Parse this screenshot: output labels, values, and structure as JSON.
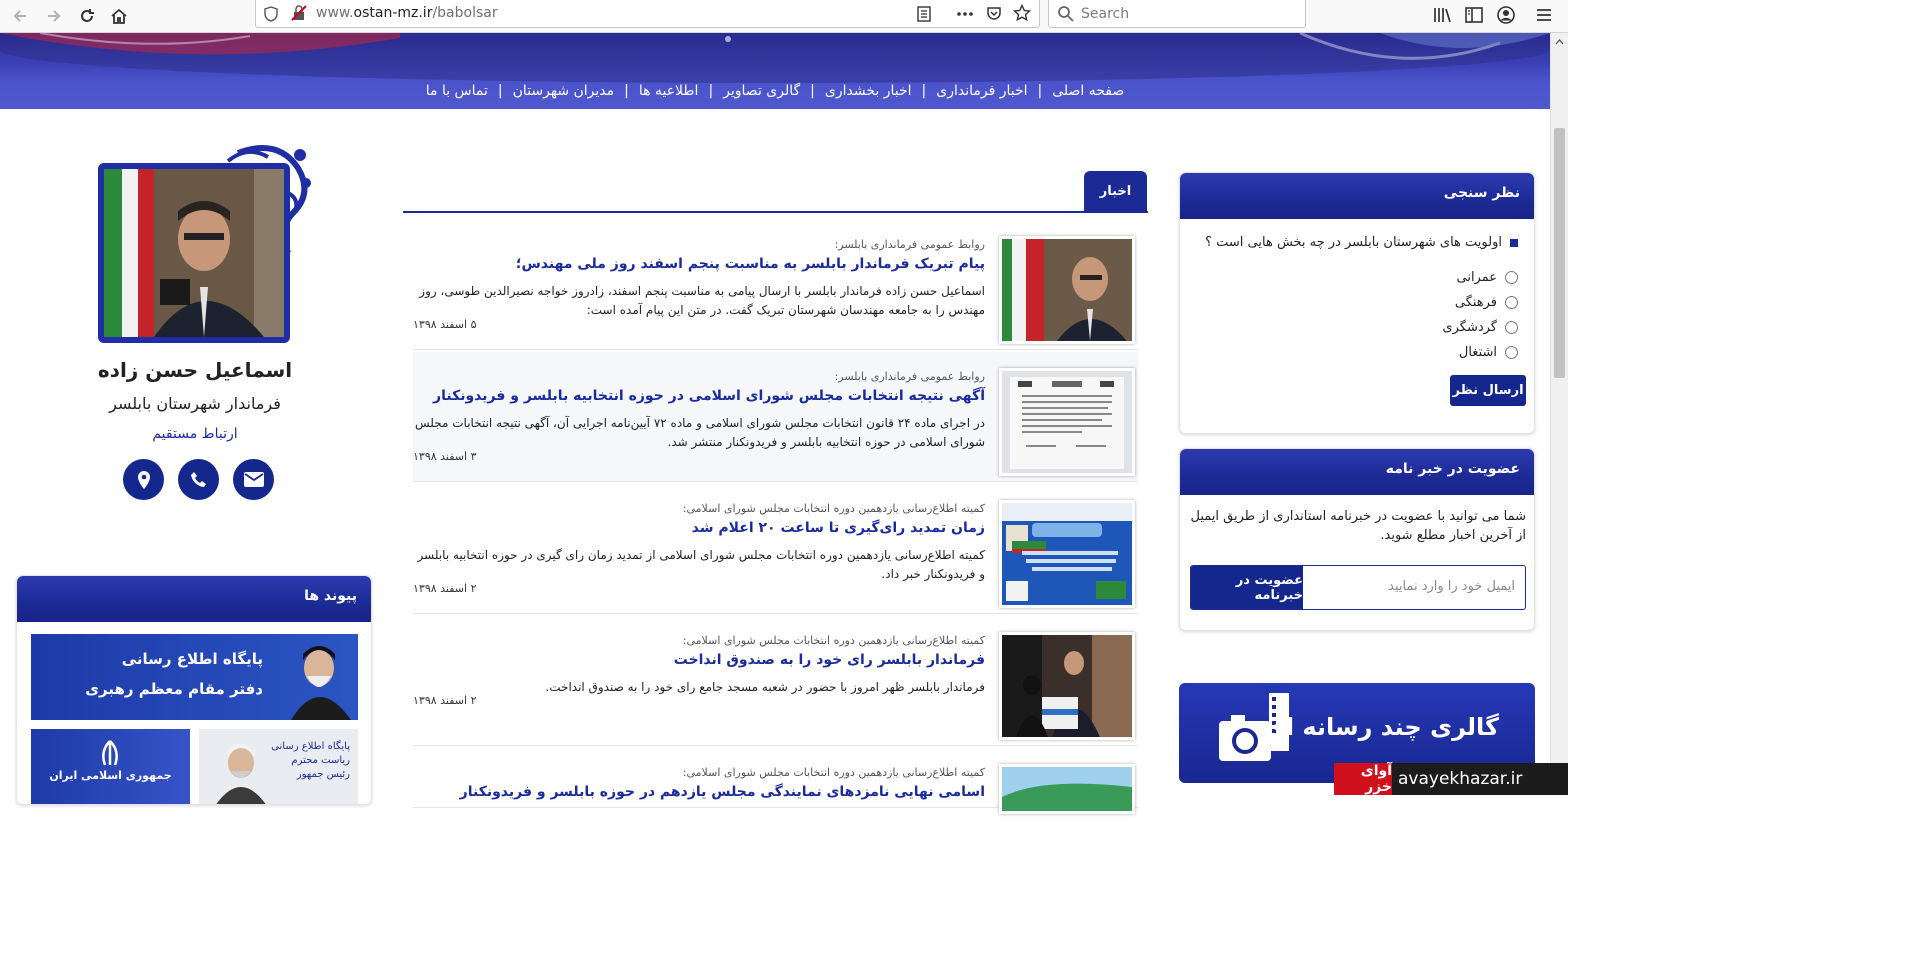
{
  "browser": {
    "url_host_prefix": "www.",
    "url_domain": "ostan-mz.ir",
    "url_path": "/babolsar",
    "search_placeholder": "Search"
  },
  "nav": {
    "items": [
      "صفحه اصلی",
      "اخبار فرمانداری",
      "اخبار بخشداری",
      "گالری تصاویر",
      "اطلاعیه ها",
      "مدیران شهرستان",
      "تماس با ما"
    ]
  },
  "poll": {
    "title": "نظر سنجی",
    "question": "اولویت های شهرستان بابلسر در چه بخش هایی است ؟",
    "options": [
      "عمرانی",
      "فرهنگی",
      "گردشگری",
      "اشتغال"
    ],
    "submit": "ارسال نظر"
  },
  "newsletter": {
    "title": "عضویت در خبر نامه",
    "text": "شما می توانید با عضویت در خبرنامه استانداری از طریق ایمیل از آخرین اخبار مطلع شوید.",
    "placeholder": "ایمیل خود را وارد نمایید",
    "button": "عضویت در خبرنامه"
  },
  "gallery_banner": {
    "text": "گالری چند رسانه ای"
  },
  "news": {
    "tab": "اخبار",
    "items": [
      {
        "source": "روابط عمومی فرمانداری بابلسر:",
        "title": "پیام تبریک فرماندار بابلسر به مناسبت پنجم اسفند روز ملی مهندس؛",
        "desc": "اسماعیل حسن زاده فرماندار بابلسر با ارسال پیامی به مناسبت پنجم اسفند، زادروز خواجه نصیرالدین طوسی، روز مهندس را به جامعه مهندسان شهرستان تبریک گفت. در متن این پیام آمده است:",
        "date": "۵ اسفند ۱۳۹۸"
      },
      {
        "source": "روابط عمومی فرمانداری بابلسر:",
        "title": "آگهی نتیجه انتخابات مجلس شورای اسلامی در حوزه انتخابیه بابلسر و فریدونکنار",
        "desc": "در اجرای ماده ۲۴ قانون انتخابات مجلس شورای اسلامی و ماده ۷۲ آیین‌نامه اجرایی آن، آگهی نتیجه انتخابات مجلس شورای اسلامی در حوزه انتخابیه بابلسر و فریدونکنار منتشر شد.",
        "date": "۳ اسفند ۱۳۹۸"
      },
      {
        "source": "کمیته اطلاع‌رسانی یازدهمین دوره انتخابات مجلس شورای اسلامی:",
        "title": "زمان تمدید رای‌گیری تا ساعت ۲۰ اعلام شد",
        "desc": "کمیته اطلاع‌رسانی یازدهمین دوره انتخابات مجلس شورای اسلامی از تمدید زمان رای گیری در حوزه انتخابیه بابلسر و فریدونکنار خبر داد.",
        "date": "۲ اسفند ۱۳۹۸"
      },
      {
        "source": "کمیته اطلاع‌رسانی یازدهمین دوره انتخابات مجلس شورای اسلامی:",
        "title": "فرماندار بابلسر رای خود را به صندوق انداخت",
        "desc": "فرماندار بابلسر ظهر امروز با حضور در شعبه مسجد جامع رای خود را به صندوق انداخت.",
        "date": "۲ اسفند ۱۳۹۸"
      },
      {
        "source": "کمیته اطلاع‌رسانی یازدهمین دوره انتخابات مجلس شورای اسلامی:",
        "title": "اسامی نهایی نامزدهای نمایندگی مجلس یازدهم در حوزه بابلسر و فریدونکنار",
        "desc": "",
        "date": ""
      }
    ]
  },
  "profile": {
    "name": "اسماعیل حسن زاده",
    "role": "فرماندار شهرستان بابلسر",
    "contact": "ارتباط مستقیم"
  },
  "links": {
    "title": "پیوند ها",
    "banner1_line1": "پایگاه اطلاع رسانی",
    "banner1_line2": "دفتر مقام معظم رهبری",
    "banner2_text": "جمهوری اسلامی ایران",
    "banner3_line1": "پایگاه اطلاع رسانی",
    "banner3_line2": "ریاست محترم",
    "banner3_line3": "رئیس جمهور"
  },
  "watermark": {
    "brand": "آوای خزر",
    "domain": "avayekhazar.ir"
  },
  "colors": {
    "primary": "#1c2a95",
    "nav_bg": "#4a52c9",
    "title_link": "#1a2b9e"
  }
}
